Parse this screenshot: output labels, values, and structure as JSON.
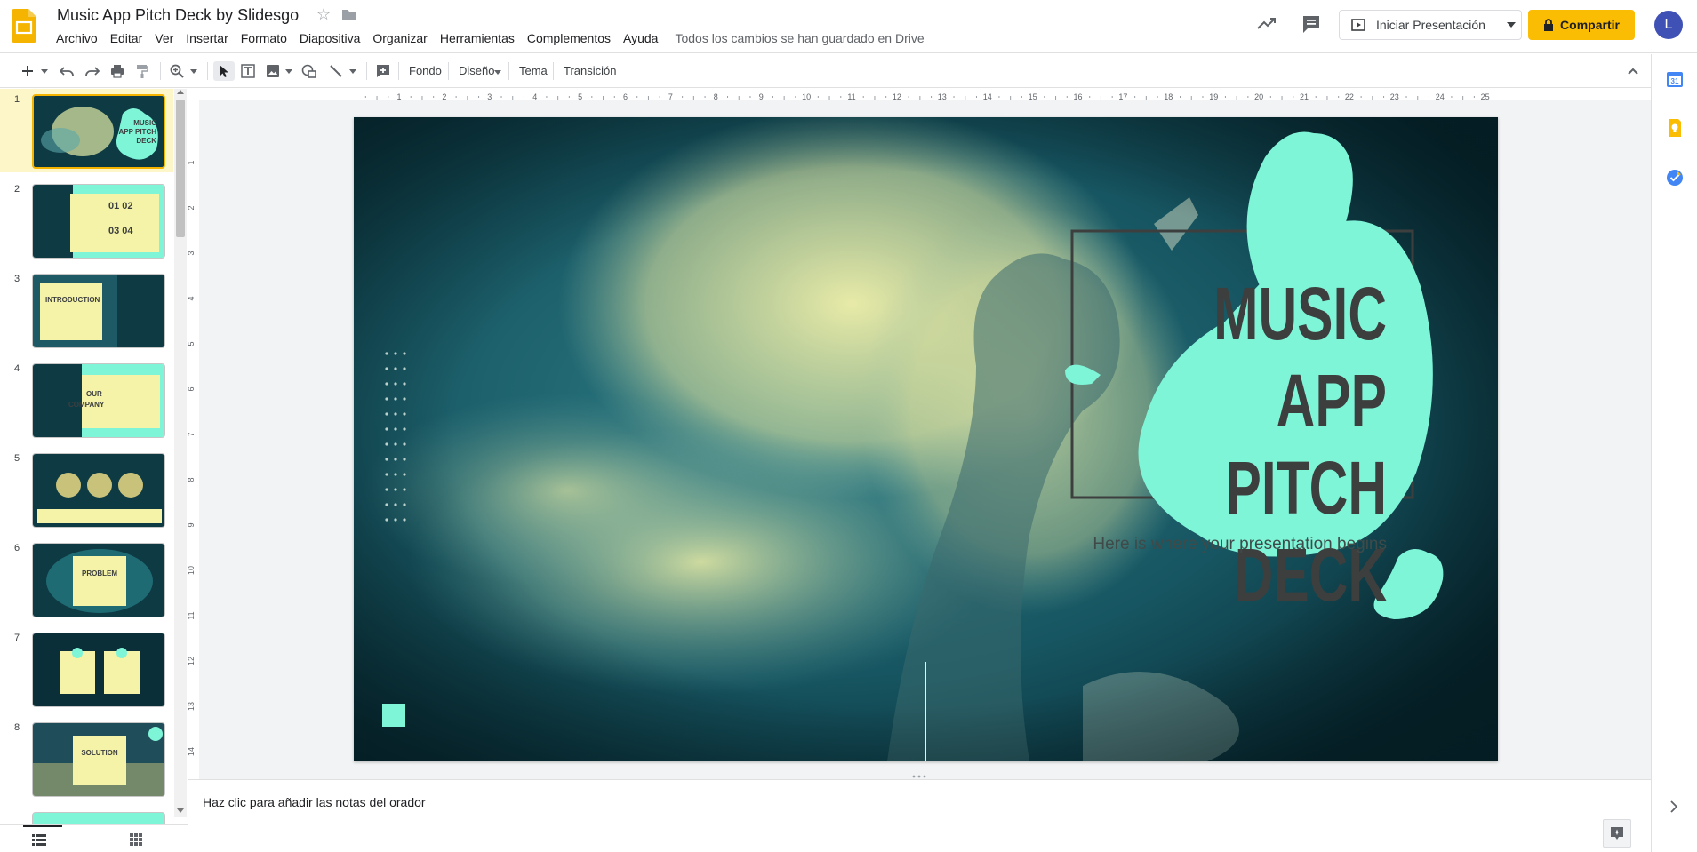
{
  "doc": {
    "title": "Music App Pitch Deck by Slidesgo",
    "saved_status": "Todos los cambios se han guardado en Drive"
  },
  "menu": [
    "Archivo",
    "Editar",
    "Ver",
    "Insertar",
    "Formato",
    "Diapositiva",
    "Organizar",
    "Herramientas",
    "Complementos",
    "Ayuda"
  ],
  "header": {
    "present_label": "Iniciar Presentación",
    "share_label": "Compartir",
    "avatar_letter": "L",
    "share_color": "#fbbc04",
    "avatar_color": "#3f51b5"
  },
  "toolbar": {
    "background_label": "Fondo",
    "layout_label": "Diseño",
    "theme_label": "Tema",
    "transition_label": "Transición"
  },
  "slides": [
    {
      "number": "1",
      "title": "MUSIC APP PITCH DECK",
      "selected": true
    },
    {
      "number": "2",
      "title": "01 02 03 04",
      "selected": false
    },
    {
      "number": "3",
      "title": "INTRODUCTION",
      "selected": false
    },
    {
      "number": "4",
      "title": "OUR COMPANY",
      "selected": false
    },
    {
      "number": "5",
      "title": "",
      "selected": false
    },
    {
      "number": "6",
      "title": "PROBLEM",
      "selected": false
    },
    {
      "number": "7",
      "title": "",
      "selected": false
    },
    {
      "number": "8",
      "title": "SOLUTION",
      "selected": false
    }
  ],
  "ruler": {
    "h_ticks": [
      "1",
      "2",
      "3",
      "4",
      "5",
      "6",
      "7",
      "8",
      "9",
      "10",
      "11",
      "12",
      "13",
      "14",
      "15",
      "16",
      "17",
      "18",
      "19",
      "20",
      "21",
      "22",
      "23",
      "24",
      "25"
    ],
    "v_ticks": [
      "1",
      "2",
      "3",
      "4",
      "5",
      "6",
      "7",
      "8",
      "9",
      "10",
      "11",
      "12",
      "13",
      "14"
    ]
  },
  "current_slide": {
    "title": "MUSIC\nAPP PITCH\nDECK",
    "subtitle": "Here is where your presentation begins",
    "accent": "#7ff5d8",
    "photo_tone": "#0e3a44",
    "smoke_tone": "#eef0a8"
  },
  "notes": {
    "placeholder": "Haz clic para añadir las notas del orador"
  }
}
